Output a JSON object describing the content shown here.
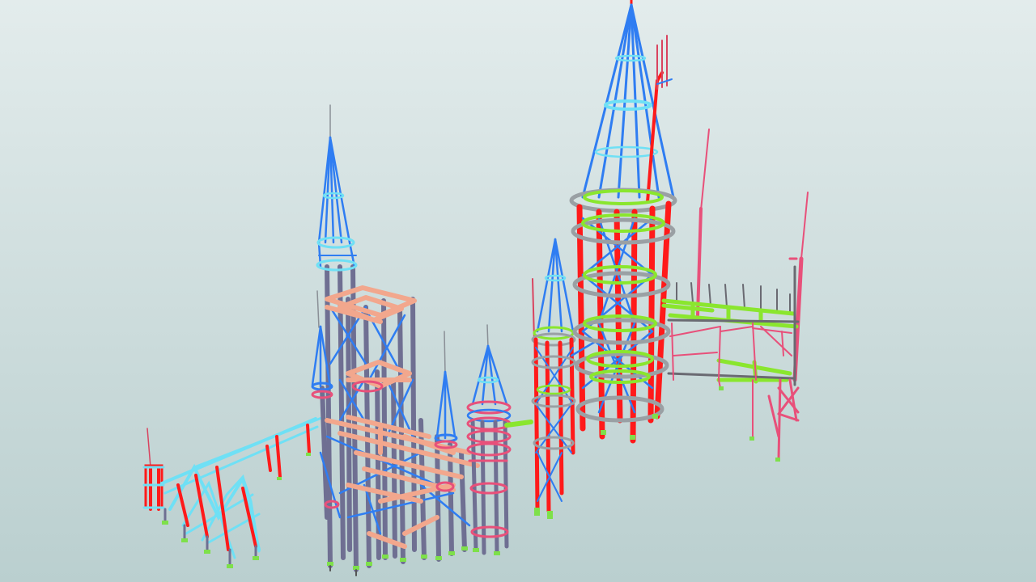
{
  "scene": {
    "background_top": "#e3ecec",
    "background_bottom": "#bacfcf",
    "palette": {
      "column_red": "#ff1a1a",
      "brace_blue": "#2f7df2",
      "ring_gray": "#9aa0a4",
      "deck_green": "#8ae62e",
      "cyan_frame": "#6fe0f5",
      "beam_salmon": "#f2a78d",
      "column_slate": "#6f6f92",
      "pink_frame": "#e8507a",
      "base_green": "#7ee04a",
      "spire_gray": "#8a8f96"
    }
  }
}
